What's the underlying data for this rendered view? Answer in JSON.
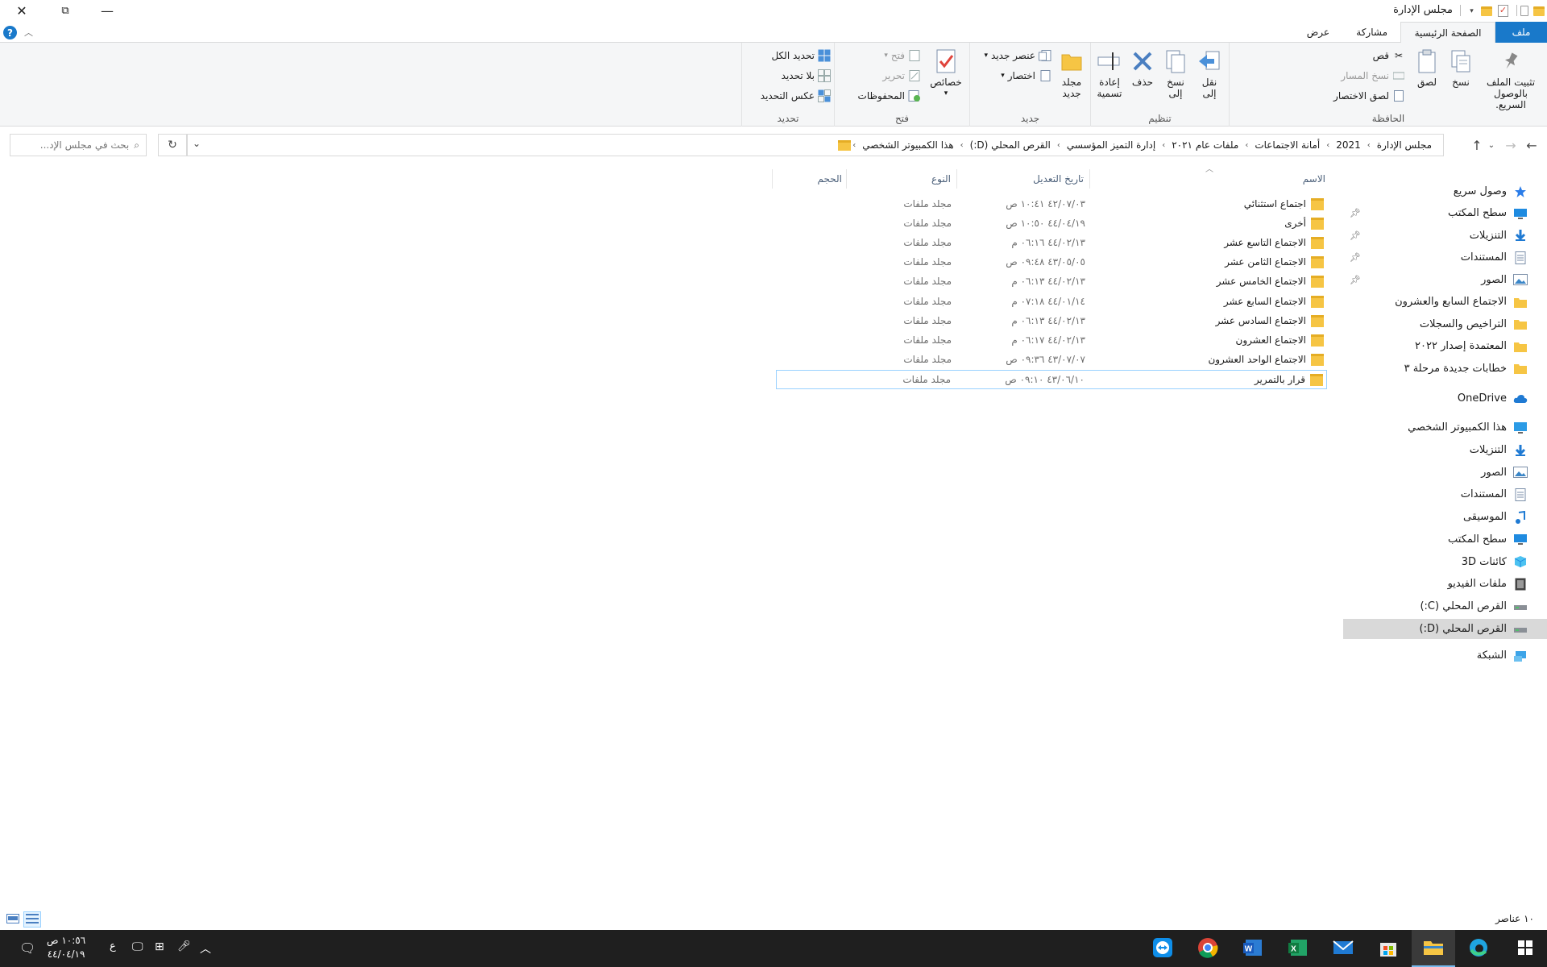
{
  "window": {
    "title": "مجلس الإدارة",
    "close": "✕",
    "maximize": "⧉",
    "minimize": "—"
  },
  "ribbon_tabs": {
    "file": "ملف",
    "home": "الصفحة الرئيسية",
    "share": "مشاركة",
    "view": "عرض",
    "help": "?"
  },
  "ribbon": {
    "clipboard": {
      "label": "الحافظة",
      "pin": "تثبيت الملف بالوصول السريع.",
      "copy": "نسخ",
      "paste": "لصق",
      "cut": "قص",
      "copy_path": "نسخ المسار",
      "paste_shortcut": "لصق الاختصار"
    },
    "organize": {
      "label": "تنظيم",
      "move_to": "نقل إلى",
      "copy_to": "نسخ إلى",
      "delete": "حذف",
      "rename": "إعادة تسمية"
    },
    "new": {
      "label": "جديد",
      "new_folder": "مجلد جديد",
      "new_item": "عنصر جديد",
      "easy_access": "اختصار"
    },
    "open": {
      "label": "فتح",
      "properties": "خصائص",
      "open": "فتح",
      "edit": "تحرير",
      "history": "المحفوظات"
    },
    "select": {
      "label": "تحديد",
      "select_all": "تحديد الكل",
      "select_none": "بلا تحديد",
      "invert": "عكس التحديد"
    }
  },
  "address": {
    "crumbs": [
      "هذا الكمبيوتر الشخصي",
      "القرص المحلي (D:)",
      "إدارة التميز المؤسسي",
      "ملفات عام ٢٠٢١",
      "أمانة الاجتماعات",
      "2021",
      "مجلس الإدارة"
    ],
    "search_placeholder": "بحث في مجلس الإد..."
  },
  "nav_pane": {
    "quick_access": "وصول سريع",
    "items": [
      {
        "label": "سطح المكتب",
        "icon": "desktop-icon",
        "pinned": true
      },
      {
        "label": "التنزيلات",
        "icon": "downloads-icon",
        "pinned": true
      },
      {
        "label": "المستندات",
        "icon": "documents-icon",
        "pinned": true
      },
      {
        "label": "الصور",
        "icon": "pictures-icon",
        "pinned": true
      },
      {
        "label": "الاجتماع السابع والعشرون",
        "icon": "folder-icon"
      },
      {
        "label": "التراخيص والسجلات",
        "icon": "folder-icon"
      },
      {
        "label": "المعتمدة إصدار ٢٠٢٢",
        "icon": "folder-icon"
      },
      {
        "label": "خطابات جديدة مرحلة ٣",
        "icon": "folder-icon"
      }
    ],
    "onedrive": "OneDrive",
    "this_pc": "هذا الكمبيوتر الشخصي",
    "pc_items": [
      {
        "label": "التنزيلات",
        "icon": "downloads-icon"
      },
      {
        "label": "الصور",
        "icon": "pictures-icon"
      },
      {
        "label": "المستندات",
        "icon": "documents-icon"
      },
      {
        "label": "الموسيقى",
        "icon": "music-icon"
      },
      {
        "label": "سطح المكتب",
        "icon": "desktop-icon"
      },
      {
        "label": "كائنات 3D",
        "icon": "3d-objects-icon"
      },
      {
        "label": "ملفات الفيديو",
        "icon": "videos-icon"
      },
      {
        "label": "القرص المحلي (C:)",
        "icon": "drive-icon"
      },
      {
        "label": "القرص المحلي (D:)",
        "icon": "drive-icon",
        "selected": true
      }
    ],
    "network": "الشبكة"
  },
  "columns": {
    "name": "الاسم",
    "date": "تاريخ التعديل",
    "type": "النوع",
    "size": "الحجم"
  },
  "files": [
    {
      "name": "اجتماع استثنائي",
      "date": "٤٢/٠٧/٠٣ ١٠:٤١ ص",
      "type": "مجلد ملفات"
    },
    {
      "name": "أخرى",
      "date": "٤٤/٠٤/١٩ ١٠:٥٠ ص",
      "type": "مجلد ملفات"
    },
    {
      "name": "الاجتماع التاسع عشر",
      "date": "٤٤/٠٢/١٣ ٠٦:١٦ م",
      "type": "مجلد ملفات"
    },
    {
      "name": "الاجتماع الثامن عشر",
      "date": "٤٣/٠٥/٠٥ ٠٩:٤٨ ص",
      "type": "مجلد ملفات"
    },
    {
      "name": "الاجتماع الخامس عشر",
      "date": "٤٤/٠٢/١٣ ٠٦:١٣ م",
      "type": "مجلد ملفات"
    },
    {
      "name": "الاجتماع السابع عشر",
      "date": "٤٤/٠١/١٤ ٠٧:١٨ م",
      "type": "مجلد ملفات"
    },
    {
      "name": "الاجتماع السادس عشر",
      "date": "٤٤/٠٢/١٣ ٠٦:١٣ م",
      "type": "مجلد ملفات"
    },
    {
      "name": "الاجتماع العشرون",
      "date": "٤٤/٠٢/١٣ ٠٦:١٧ م",
      "type": "مجلد ملفات"
    },
    {
      "name": "الاجتماع الواحد العشرون",
      "date": "٤٣/٠٧/٠٧ ٠٩:٣٦ ص",
      "type": "مجلد ملفات"
    },
    {
      "name": "قرار بالتمرير",
      "date": "٤٣/٠٦/١٠ ٠٩:١٠ ص",
      "type": "مجلد ملفات",
      "selected": true
    }
  ],
  "status": {
    "item_count": "١٠ عناصر"
  },
  "taskbar": {
    "time": "١٠:٥٦ ص",
    "date": "٤٤/٠٤/١٩",
    "lang": "ع"
  },
  "colors": {
    "accent": "#1979ca",
    "folder": "#f6c544",
    "taskbar": "#1f1f1f"
  }
}
